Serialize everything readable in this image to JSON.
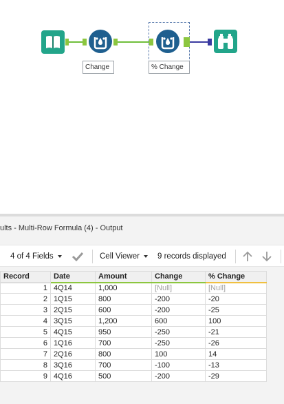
{
  "workflow": {
    "tools": [
      {
        "id": "input",
        "icon": "book-icon",
        "color": "#22a58a"
      },
      {
        "id": "multirow1",
        "icon": "multi-row-formula-icon",
        "color": "#1e5f8f"
      },
      {
        "id": "multirow2",
        "icon": "multi-row-formula-icon",
        "color": "#1e5f8f"
      },
      {
        "id": "browse",
        "icon": "binoculars-icon",
        "color": "#22a58a"
      }
    ],
    "labels": {
      "change": "Change",
      "pct_change": "% Change"
    }
  },
  "results": {
    "title": "ults - Multi-Row Formula (4) - Output",
    "toolbar": {
      "fields": "4 of 4 Fields",
      "cell_viewer": "Cell Viewer",
      "records_displayed": "9 records displayed"
    },
    "columns": [
      "Record",
      "Date",
      "Amount",
      "Change",
      "% Change"
    ],
    "rows": [
      [
        "1",
        "4Q14",
        "1,000",
        "[Null]",
        "[Null]"
      ],
      [
        "2",
        "1Q15",
        "800",
        "-200",
        "-20"
      ],
      [
        "3",
        "2Q15",
        "600",
        "-200",
        "-25"
      ],
      [
        "4",
        "3Q15",
        "1,200",
        "600",
        "100"
      ],
      [
        "5",
        "4Q15",
        "950",
        "-250",
        "-21"
      ],
      [
        "6",
        "1Q16",
        "700",
        "-250",
        "-26"
      ],
      [
        "7",
        "2Q16",
        "800",
        "100",
        "14"
      ],
      [
        "8",
        "3Q16",
        "700",
        "-100",
        "-13"
      ],
      [
        "9",
        "4Q16",
        "500",
        "-200",
        "-29"
      ]
    ]
  }
}
